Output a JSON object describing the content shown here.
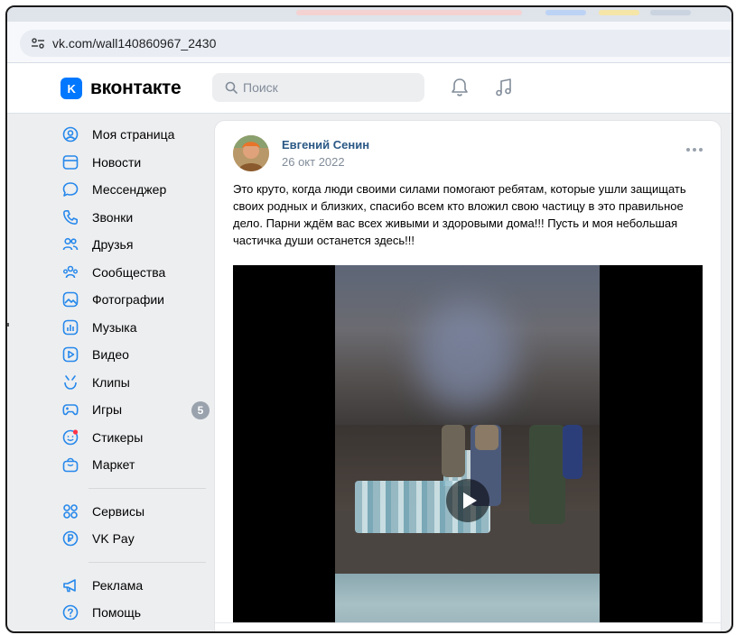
{
  "browser": {
    "url": "vk.com/wall140860967_2430"
  },
  "header": {
    "logo_text": "вконтакте",
    "logo_mark": "K",
    "search_placeholder": "Поиск",
    "icons": [
      "bell-icon",
      "music-note-icon"
    ]
  },
  "sidebar": {
    "items": [
      {
        "label": "Моя страница",
        "icon": "user-circle-icon"
      },
      {
        "label": "Новости",
        "icon": "news-icon"
      },
      {
        "label": "Мессенджер",
        "icon": "message-bubble-icon"
      },
      {
        "label": "Звонки",
        "icon": "phone-icon"
      },
      {
        "label": "Друзья",
        "icon": "friends-icon"
      },
      {
        "label": "Сообщества",
        "icon": "communities-icon"
      },
      {
        "label": "Фотографии",
        "icon": "photo-icon"
      },
      {
        "label": "Музыка",
        "icon": "music-icon"
      },
      {
        "label": "Видео",
        "icon": "video-icon"
      },
      {
        "label": "Клипы",
        "icon": "clips-icon"
      },
      {
        "label": "Игры",
        "icon": "gamepad-icon",
        "badge": "5"
      },
      {
        "label": "Стикеры",
        "icon": "sticker-icon"
      },
      {
        "label": "Маркет",
        "icon": "market-bag-icon"
      }
    ],
    "items2": [
      {
        "label": "Сервисы",
        "icon": "services-grid-icon"
      },
      {
        "label": "VK Pay",
        "icon": "vkpay-icon"
      }
    ],
    "items3": [
      {
        "label": "Реклама",
        "icon": "megaphone-icon"
      },
      {
        "label": "Помощь",
        "icon": "help-icon"
      }
    ]
  },
  "post": {
    "author": "Евгений Сенин",
    "date": "26 окт 2022",
    "text": "Это круто, когда люди своими силами помогают ребятам, которые ушли защищать своих родных и близких, спасибо всем кто вложил свою частицу в это правильное дело. Парни ждём вас всех живыми и здоровыми дома!!! Пусть и моя небольшая частичка души останется здесь!!!"
  },
  "colors": {
    "accent": "#0077ff",
    "link": "#2a5885",
    "background": "#edeef0"
  }
}
